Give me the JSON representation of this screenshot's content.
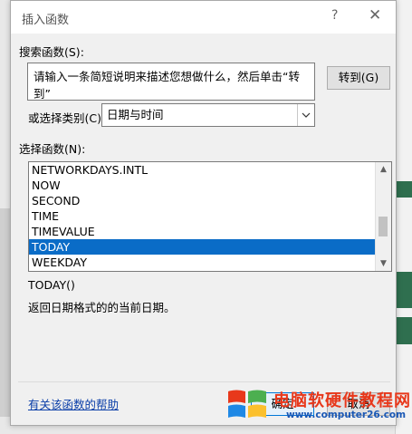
{
  "dialog": {
    "title": "插入函数",
    "help_glyph": "?",
    "close_glyph": "✕"
  },
  "search": {
    "label": "搜索函数(S):",
    "value": "请输入一条简短说明来描述您想做什么，然后单击“转到”",
    "goto_label": "转到(G)"
  },
  "category": {
    "label": "或选择类别(C):",
    "selected": "日期与时间"
  },
  "functions": {
    "label": "选择函数(N):",
    "items": [
      "NETWORKDAYS.INTL",
      "NOW",
      "SECOND",
      "TIME",
      "TIMEVALUE",
      "TODAY",
      "WEEKDAY"
    ],
    "selected": "TODAY"
  },
  "detail": {
    "signature": "TODAY()",
    "description": "返回日期格式的的当前日期。"
  },
  "footer": {
    "help_link": "有关该函数的帮助",
    "ok_label": "确定",
    "cancel_label": "取消"
  },
  "watermark": {
    "title": "电脑软硬件教程网",
    "url": "www.computer26.com"
  },
  "colors": {
    "selection": "#0a6cc7",
    "link": "#0a3ea8",
    "watermark_red": "#e8381b",
    "watermark_blue": "#1a58b5"
  }
}
